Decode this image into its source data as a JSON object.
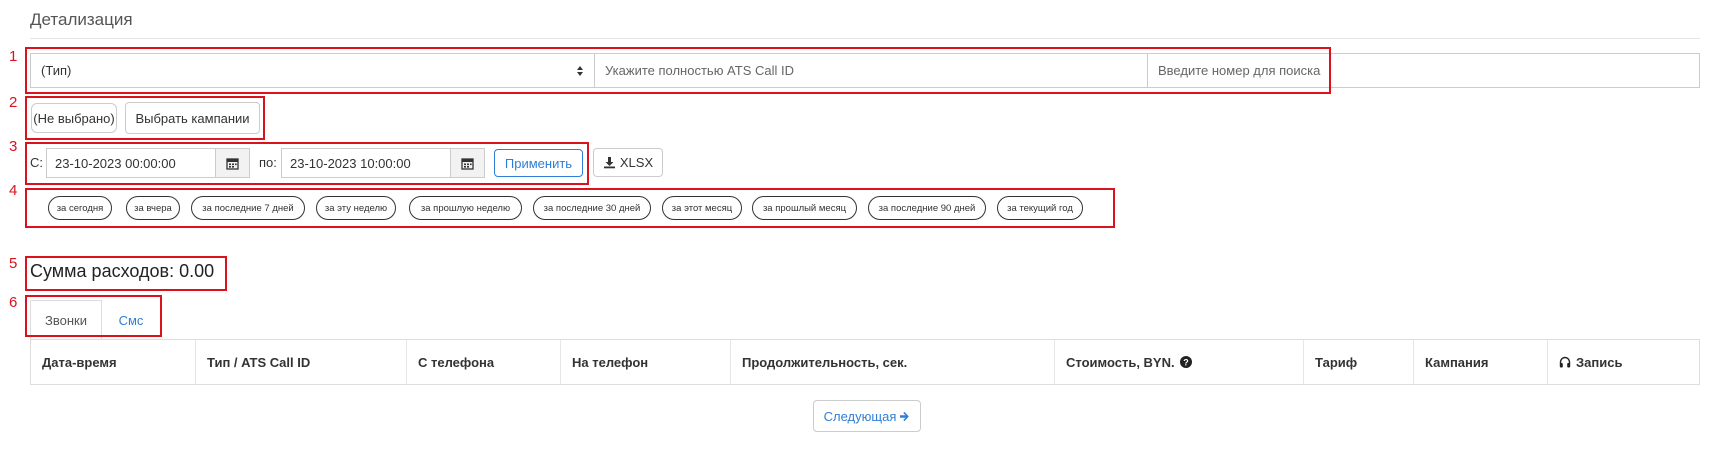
{
  "page": {
    "title": "Детализация"
  },
  "markers": [
    "1",
    "2",
    "3",
    "4",
    "5",
    "6"
  ],
  "filters": {
    "type_select": "(Тип)",
    "call_id_placeholder": "Укажите полностью ATS Call ID",
    "search_placeholder": "Введите номер для поиска"
  },
  "campaigns": {
    "selected": "(Не выбрано)",
    "choose_button": "Выбрать кампании"
  },
  "period": {
    "from_label": "С:",
    "from_value": "23-10-2023 00:00:00",
    "to_label": "по:",
    "to_value": "23-10-2023 10:00:00",
    "apply_button": "Применить",
    "export_button": "XLSX"
  },
  "quick_ranges": [
    "за сегодня",
    "за вчера",
    "за последние 7 дней",
    "за эту неделю",
    "за прошлую неделю",
    "за последние 30 дней",
    "за этот месяц",
    "за прошлый месяц",
    "за последние 90 дней",
    "за текущий год"
  ],
  "summary": {
    "text": "Сумма расходов: 0.00"
  },
  "tabs": [
    {
      "label": "Звонки",
      "active": true
    },
    {
      "label": "Смс",
      "active": false
    }
  ],
  "table": {
    "columns": [
      "Дата-время",
      "Тип / ATS Call ID",
      "С телефона",
      "На телефон",
      "Продолжительность, сек.",
      "Стоимость, BYN.",
      "Тариф",
      "Кампания",
      "Запись"
    ]
  },
  "pagination": {
    "next_label": "Следующая"
  },
  "colors": {
    "accent": "#2f7fd6",
    "annotation": "#d9121e"
  },
  "icons": {
    "select_caret": "sort-caret-icon",
    "calendar": "calendar-icon",
    "download": "download-icon",
    "help": "question-circle-icon",
    "headphones": "headphones-icon",
    "arrow": "arrow-right-icon"
  }
}
